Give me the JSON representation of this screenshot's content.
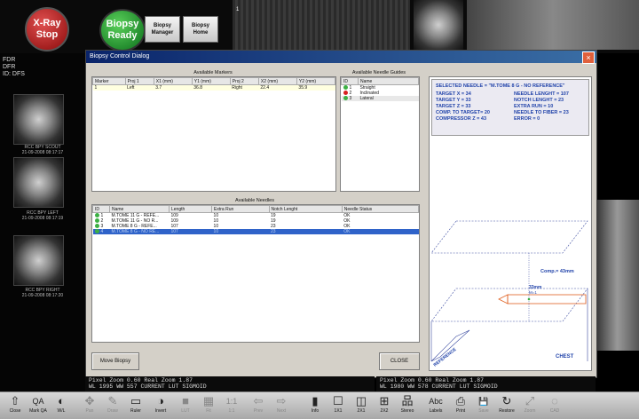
{
  "top": {
    "xray_stop": "X-Ray\nStop",
    "biopsy_ready": "Biopsy\nReady",
    "biopsy_manager": "Biopsy\nManager",
    "biopsy_home": "Biopsy\nHome",
    "view_marker": "1"
  },
  "left": {
    "info_lines": [
      "FDR",
      "DFR",
      "ID: DFS"
    ],
    "thumbs": [
      {
        "label1": "RCC BPY SCOUT",
        "label2": "21-09-2008 08:17:17"
      },
      {
        "label1": "RCC BPY LEFT",
        "label2": "21-09-2008 08:17:19"
      },
      {
        "label1": "RCC BPY RIGHT",
        "label2": "21-09-2008 08:17:20"
      }
    ]
  },
  "dialog": {
    "title": "Biopsy Control Dialog",
    "close_icon": "×",
    "markers": {
      "caption": "Available Markers",
      "headers": [
        "Marker",
        "Proj 1",
        "X1 (mm)",
        "Y1 (mm)",
        "Proj 2",
        "X2 (mm)",
        "Y2 (mm)"
      ],
      "rows": [
        [
          "1",
          "Left",
          "3.7",
          "36.8",
          "Right",
          "22.4",
          "35.9"
        ]
      ]
    },
    "guides": {
      "caption": "Available Needle Guides",
      "headers": [
        "ID",
        "Name"
      ],
      "rows": [
        {
          "id": "1",
          "name": "Straight",
          "color": "#3cb043"
        },
        {
          "id": "2",
          "name": "Inclinated",
          "color": "#d82020"
        },
        {
          "id": "3",
          "name": "Lateral",
          "color": "#3cb043"
        }
      ]
    },
    "needles": {
      "caption": "Available Needles",
      "headers": [
        "ID",
        "Name",
        "Length",
        "Extra Run",
        "Notch Lenght",
        "Needle Status"
      ],
      "rows": [
        {
          "id": "1",
          "name": "M.TOME 11 G - REFE...",
          "length": "109",
          "extra": "10",
          "notch": "19",
          "status": "OK",
          "color": "#3cb043"
        },
        {
          "id": "2",
          "name": "M.TOME 11 G - NO R...",
          "length": "109",
          "extra": "10",
          "notch": "19",
          "status": "OK",
          "color": "#3cb043"
        },
        {
          "id": "3",
          "name": "M.TOME 8 G - REFE...",
          "length": "107",
          "extra": "10",
          "notch": "23",
          "status": "OK",
          "color": "#3cb043"
        },
        {
          "id": "4",
          "name": "M.TOME 8 G - NO RE...",
          "length": "107",
          "extra": "10",
          "notch": "23",
          "status": "OK",
          "color": "#3cb043"
        }
      ]
    },
    "info": {
      "selected": "SELECTED NEEDLE = \"M.TOME 8 G - NO REFERENCE\"",
      "left": [
        "TARGET X = 34",
        "TARGET Y = 33",
        "TARGET Z = 33",
        "COMP. TO TARGET= 20",
        "COMPRESSOR Z = 43"
      ],
      "right": [
        "NEEDLE LENGHT = 107",
        "NOTCH LENGHT = 23",
        "EXTRA RUN = 10",
        "NEEDLE TO FIBER = 23",
        "ERROR = 0"
      ]
    },
    "diagram": {
      "comp": "Comp.= 43mm",
      "mm": "33mm",
      "mm2": "M=1",
      "chest": "CHEST",
      "reference": "REFERENCE"
    },
    "move_biopsy": "Move Biopsy",
    "close": "CLOSE"
  },
  "zoom_left": {
    "line1": "Pixel Zoom  0.60 Real Zoom  1.87",
    "line2": "WL  1995 WW  557 CURRENT LUT SIGMOID"
  },
  "zoom_right": {
    "line1": "Pixel Zoom  0.60 Real Zoom  1.87",
    "line2": "WL  1980 WW  578 CURRENT LUT SIGMOID"
  },
  "toolbar": [
    {
      "icon": "⇧",
      "label": "Close",
      "name": "close-tool",
      "dim": false
    },
    {
      "icon": "QA",
      "label": "Mark QA",
      "name": "mark-qa-tool",
      "dim": false
    },
    {
      "icon": "◐",
      "label": "W/L",
      "name": "window-level-tool",
      "dim": false
    },
    {
      "icon": "✥",
      "label": "Pan",
      "name": "pan-tool",
      "dim": true
    },
    {
      "icon": "✎",
      "label": "Draw",
      "name": "draw-tool",
      "dim": true
    },
    {
      "icon": "▭",
      "label": "Ruler",
      "name": "ruler-tool",
      "dim": false
    },
    {
      "icon": "◑",
      "label": "Invert",
      "name": "invert-tool",
      "dim": false
    },
    {
      "icon": "■",
      "label": "LUT",
      "name": "lut-tool",
      "dim": true
    },
    {
      "icon": "▦",
      "label": "Fit",
      "name": "fit-tool",
      "dim": true
    },
    {
      "icon": "1:1",
      "label": "1:1",
      "name": "one-to-one-tool",
      "dim": true
    },
    {
      "icon": "⇦",
      "label": "Prev",
      "name": "prev-tool",
      "dim": true
    },
    {
      "icon": "⇨",
      "label": "Next",
      "name": "next-tool",
      "dim": true
    },
    {
      "icon": "▮",
      "label": "Info",
      "name": "info-tool",
      "dim": false
    },
    {
      "icon": "☐",
      "label": "1X1",
      "name": "layout-1x1-tool",
      "dim": false
    },
    {
      "icon": "◫",
      "label": "2X1",
      "name": "layout-2x1-tool",
      "dim": false
    },
    {
      "icon": "⊞",
      "label": "2X2",
      "name": "layout-2x2-tool",
      "dim": false
    },
    {
      "icon": "品",
      "label": "Stereo",
      "name": "stereo-tool",
      "dim": false
    },
    {
      "icon": "Abc",
      "label": "Labels",
      "name": "labels-tool",
      "dim": false
    },
    {
      "icon": "⎙",
      "label": "Print",
      "name": "print-tool",
      "dim": false
    },
    {
      "icon": "💾",
      "label": "Save",
      "name": "save-tool",
      "dim": true
    },
    {
      "icon": "↻",
      "label": "Restore",
      "name": "restore-tool",
      "dim": false
    },
    {
      "icon": "⤢",
      "label": "Zoom",
      "name": "zoom-tool",
      "dim": true
    },
    {
      "icon": "◌",
      "label": "CAD",
      "name": "cad-tool",
      "dim": true
    }
  ]
}
